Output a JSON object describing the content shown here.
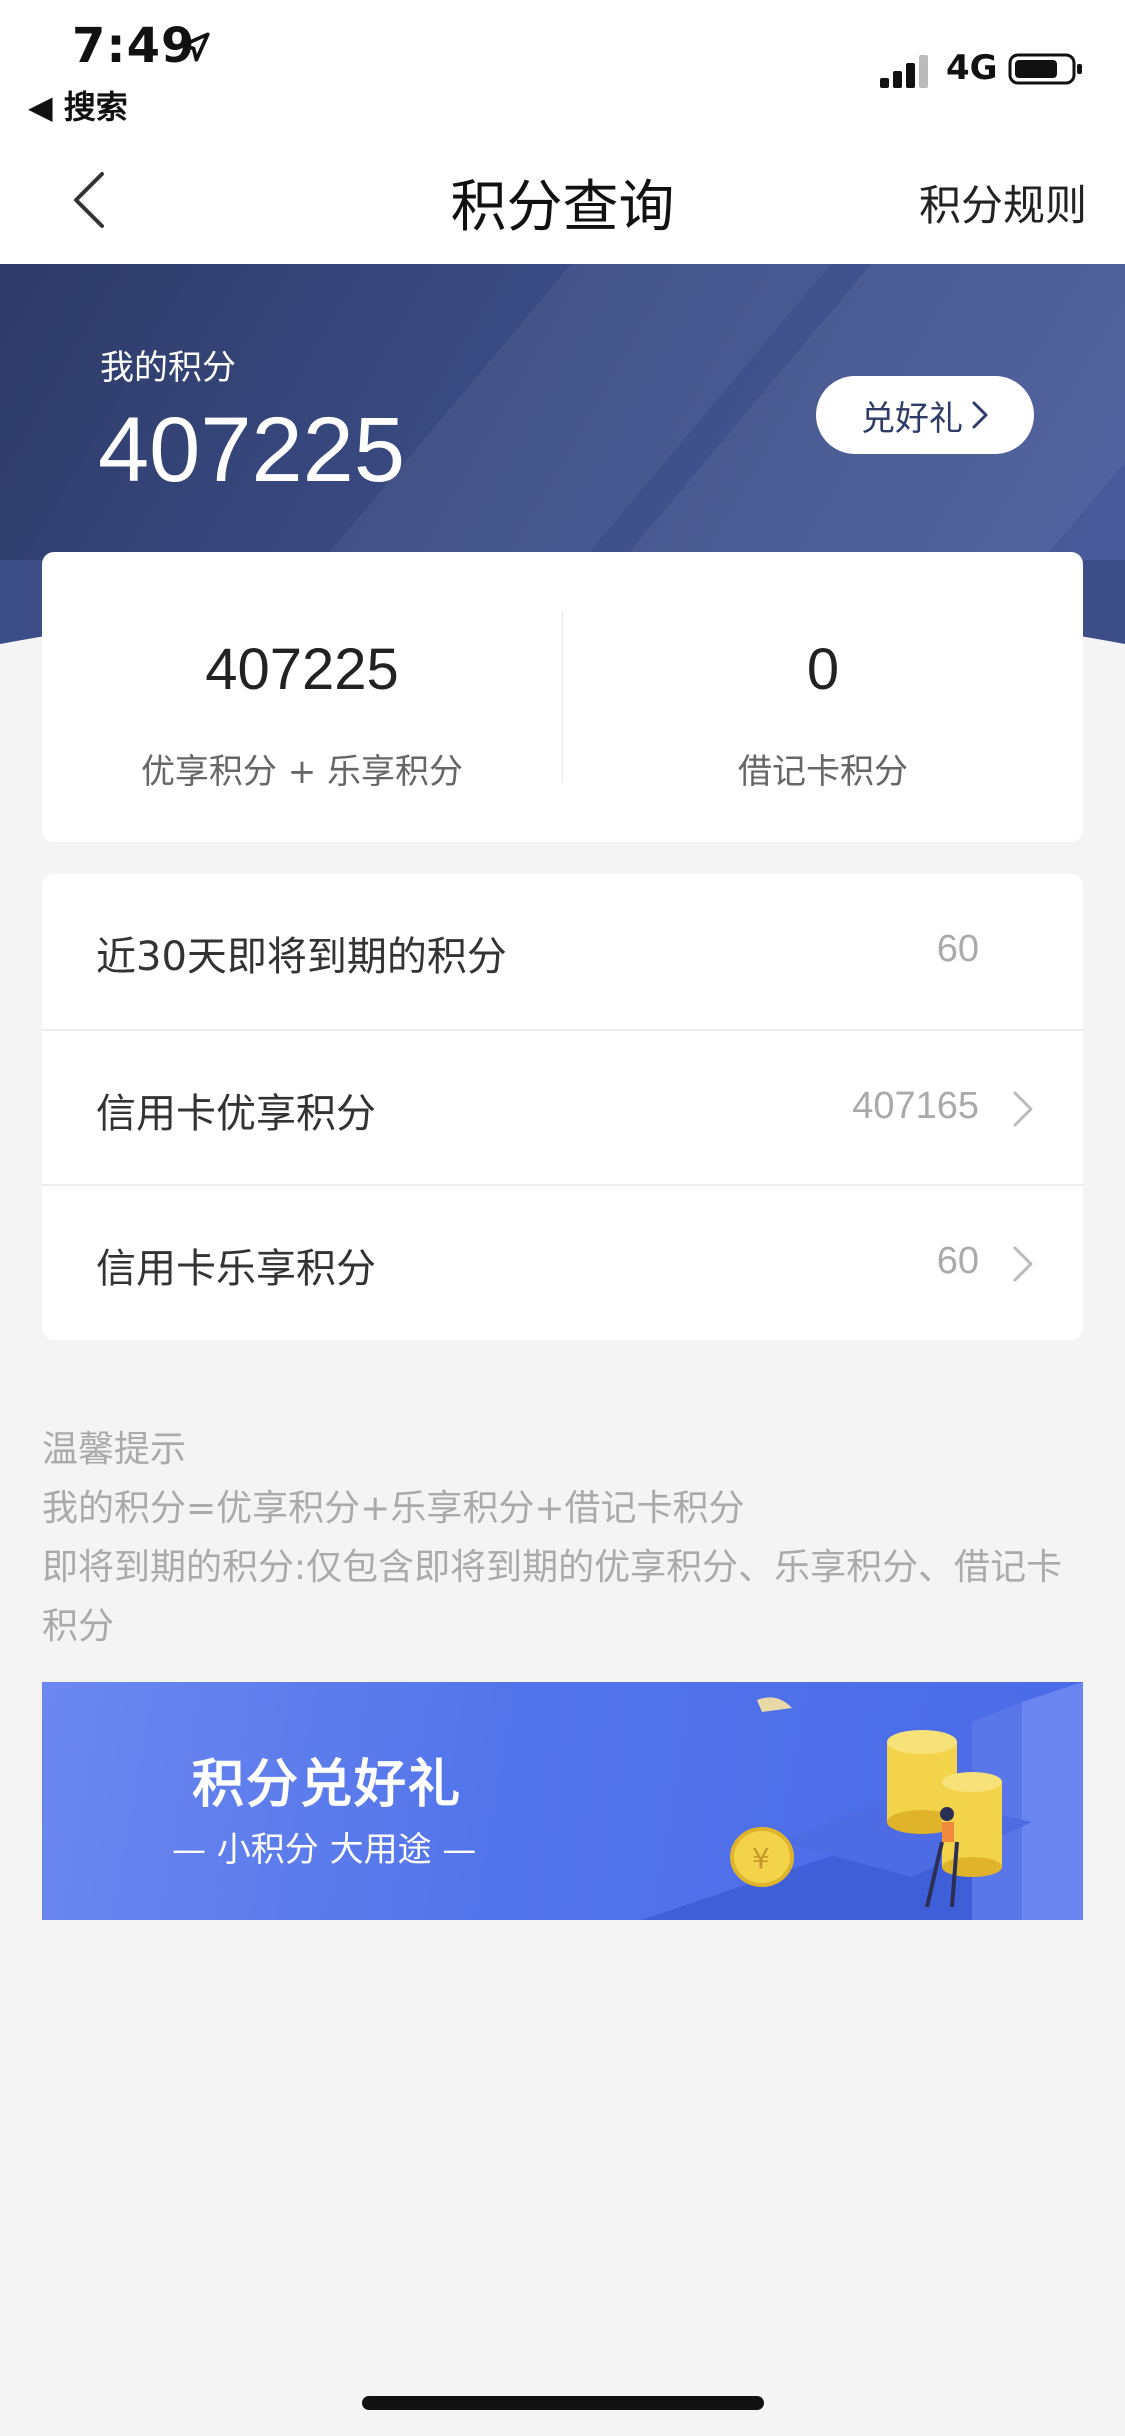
{
  "status_bar": {
    "time": "7:49",
    "back_app": "◀ 搜索",
    "network": "4G"
  },
  "nav": {
    "title": "积分查询",
    "right_link": "积分规则"
  },
  "hero": {
    "label": "我的积分",
    "value": "407225",
    "redeem_button": "兑好礼"
  },
  "summary": {
    "left_value": "407225",
    "left_label": "优享积分 + 乐享积分",
    "right_value": "0",
    "right_label": "借记卡积分"
  },
  "rows": [
    {
      "label": "近30天即将到期的积分",
      "value": "60",
      "has_chevron": false
    },
    {
      "label": "信用卡优享积分",
      "value": "407165",
      "has_chevron": true
    },
    {
      "label": "信用卡乐享积分",
      "value": "60",
      "has_chevron": true
    }
  ],
  "tips": {
    "title": "温馨提示",
    "line1": "我的积分=优享积分+乐享积分+借记卡积分",
    "line2": "即将到期的积分:仅包含即将到期的优享积分、乐享积分、借记卡积分"
  },
  "promo": {
    "title": "积分兑好礼",
    "subtitle": "— 小积分 大用途 —"
  },
  "colors": {
    "hero_dark": "#2e3b68",
    "hero_light": "#4a5c9c",
    "promo_blue": "#5274ea",
    "coin_gold": "#f2d34a"
  }
}
